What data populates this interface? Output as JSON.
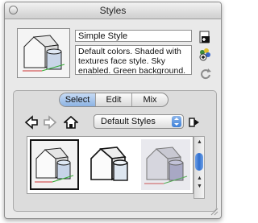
{
  "window": {
    "title": "Styles"
  },
  "style": {
    "name": "Simple Style",
    "description": "Default colors.  Shaded with textures face style.  Sky enabled.  Green background."
  },
  "tabs": [
    {
      "label": "Select",
      "active": true
    },
    {
      "label": "Edit",
      "active": false
    },
    {
      "label": "Mix",
      "active": false
    }
  ],
  "collection": {
    "selected": "Default Styles"
  },
  "icons": {
    "close": "close-icon",
    "create": "create-style-icon",
    "update": "update-style-icon",
    "refresh": "refresh-icon",
    "back": "back-arrow-icon",
    "forward": "forward-arrow-icon",
    "home": "home-icon",
    "details": "details-icon",
    "resize": "resize-grip-icon"
  },
  "colors": {
    "accent": "#3b7fd8",
    "tab_active": "#9dbde6"
  }
}
